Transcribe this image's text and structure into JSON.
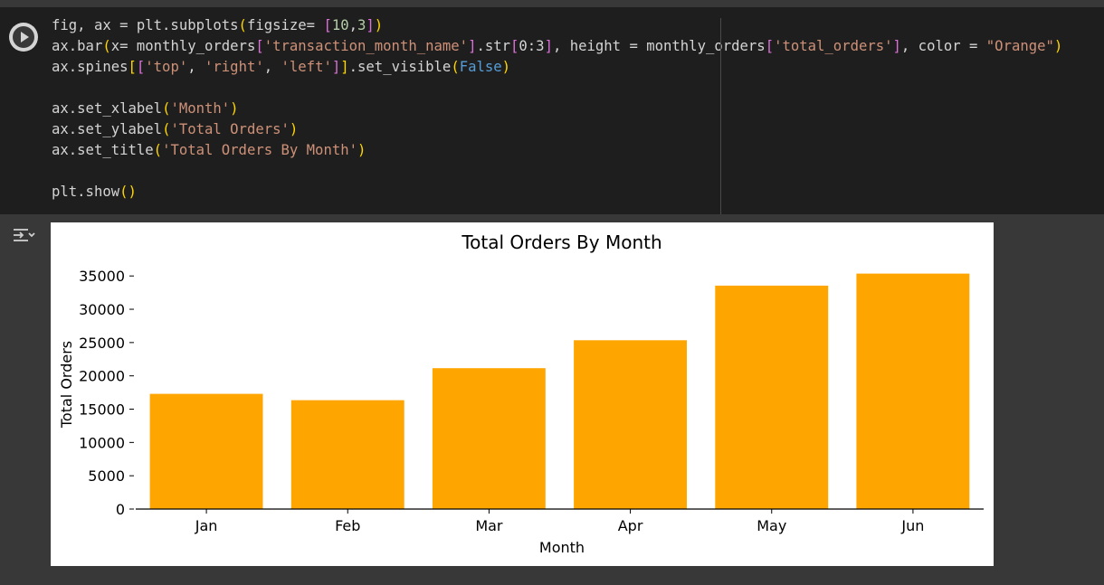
{
  "cell": {
    "code_lines": [
      [
        {
          "t": "fig, ax = plt.subplots",
          "c": ""
        },
        {
          "t": "(",
          "c": "t-br"
        },
        {
          "t": "figsize= ",
          "c": ""
        },
        {
          "t": "[",
          "c": "t-br2"
        },
        {
          "t": "10",
          "c": "t-num"
        },
        {
          "t": ",",
          "c": ""
        },
        {
          "t": "3",
          "c": "t-num"
        },
        {
          "t": "]",
          "c": "t-br2"
        },
        {
          "t": ")",
          "c": "t-br"
        }
      ],
      [
        {
          "t": "ax.bar",
          "c": ""
        },
        {
          "t": "(",
          "c": "t-br"
        },
        {
          "t": "x= monthly_orders",
          "c": ""
        },
        {
          "t": "[",
          "c": "t-br2"
        },
        {
          "t": "'transaction_month_name'",
          "c": "t-str"
        },
        {
          "t": "]",
          "c": "t-br2"
        },
        {
          "t": ".str",
          "c": ""
        },
        {
          "t": "[",
          "c": "t-br2"
        },
        {
          "t": "0:3",
          "c": ""
        },
        {
          "t": "]",
          "c": "t-br2"
        },
        {
          "t": ", height = monthly_orders",
          "c": ""
        },
        {
          "t": "[",
          "c": "t-br2"
        },
        {
          "t": "'total_orders'",
          "c": "t-str"
        },
        {
          "t": "]",
          "c": "t-br2"
        },
        {
          "t": ", color = ",
          "c": ""
        },
        {
          "t": "\"Orange\"",
          "c": "t-str"
        },
        {
          "t": ")",
          "c": "t-br"
        }
      ],
      [
        {
          "t": "ax.spines",
          "c": ""
        },
        {
          "t": "[",
          "c": "t-br"
        },
        {
          "t": "[",
          "c": "t-br2"
        },
        {
          "t": "'top'",
          "c": "t-str"
        },
        {
          "t": ", ",
          "c": ""
        },
        {
          "t": "'right'",
          "c": "t-str"
        },
        {
          "t": ", ",
          "c": ""
        },
        {
          "t": "'left'",
          "c": "t-str"
        },
        {
          "t": "]",
          "c": "t-br2"
        },
        {
          "t": "]",
          "c": "t-br"
        },
        {
          "t": ".set_visible",
          "c": ""
        },
        {
          "t": "(",
          "c": "t-br"
        },
        {
          "t": "False",
          "c": "t-kw"
        },
        {
          "t": ")",
          "c": "t-br"
        }
      ],
      [],
      [
        {
          "t": "ax.set_xlabel",
          "c": ""
        },
        {
          "t": "(",
          "c": "t-br"
        },
        {
          "t": "'Month'",
          "c": "t-str"
        },
        {
          "t": ")",
          "c": "t-br"
        }
      ],
      [
        {
          "t": "ax.set_ylabel",
          "c": ""
        },
        {
          "t": "(",
          "c": "t-br"
        },
        {
          "t": "'Total Orders'",
          "c": "t-str"
        },
        {
          "t": ")",
          "c": "t-br"
        }
      ],
      [
        {
          "t": "ax.set_title",
          "c": ""
        },
        {
          "t": "(",
          "c": "t-br"
        },
        {
          "t": "'Total Orders By Month'",
          "c": "t-str"
        },
        {
          "t": ")",
          "c": "t-br"
        }
      ],
      [],
      [
        {
          "t": "plt.show",
          "c": ""
        },
        {
          "t": "(",
          "c": "t-br"
        },
        {
          "t": ")",
          "c": "t-br"
        }
      ]
    ],
    "run_icon": "play-icon",
    "output_icon": "output-toggle-icon"
  },
  "chart_data": {
    "type": "bar",
    "title": "Total Orders By Month",
    "xlabel": "Month",
    "ylabel": "Total Orders",
    "categories": [
      "Jan",
      "Feb",
      "Mar",
      "Apr",
      "May",
      "Jun"
    ],
    "values": [
      17300,
      16350,
      21150,
      25350,
      33550,
      35350
    ],
    "ylim": [
      0,
      37200
    ],
    "yticks": [
      0,
      5000,
      10000,
      15000,
      20000,
      25000,
      30000,
      35000
    ],
    "bar_color": "#FFA500",
    "grid": false,
    "spines_visible": [
      "bottom"
    ]
  }
}
